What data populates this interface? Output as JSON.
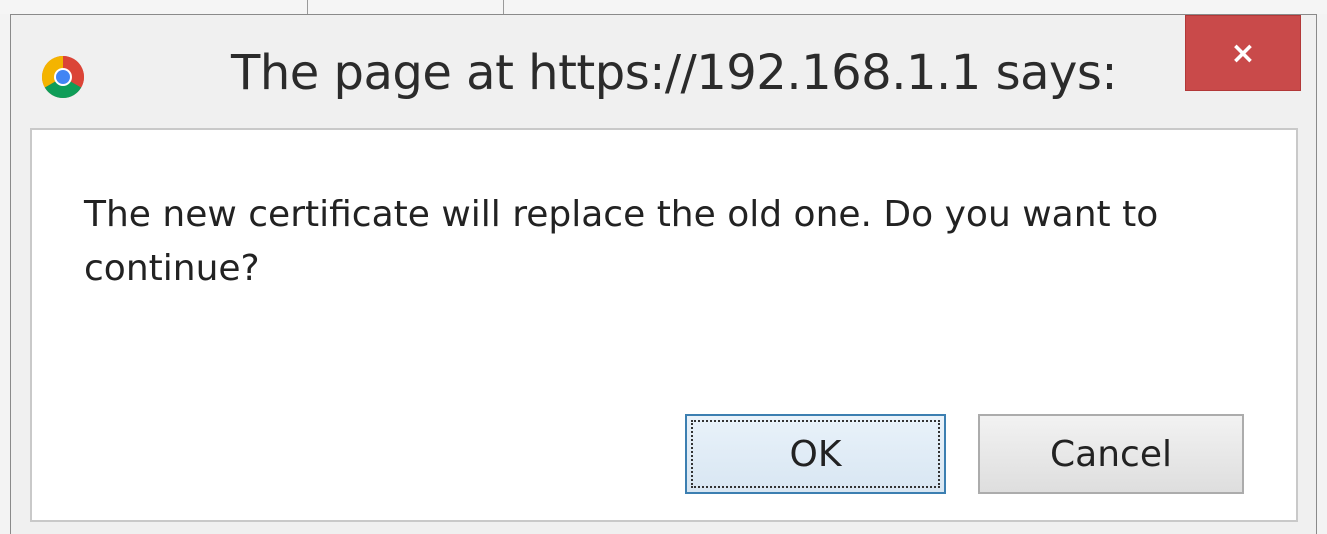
{
  "dialog": {
    "title": "The page at https://192.168.1.1 says:",
    "close_label": "×",
    "message": "The new certificate will replace the old one. Do you want to continue?",
    "ok_label": "OK",
    "cancel_label": "Cancel",
    "app_icon": "chrome-icon"
  },
  "colors": {
    "close_button": "#c94a4a",
    "ok_border": "#3c7fb1"
  }
}
